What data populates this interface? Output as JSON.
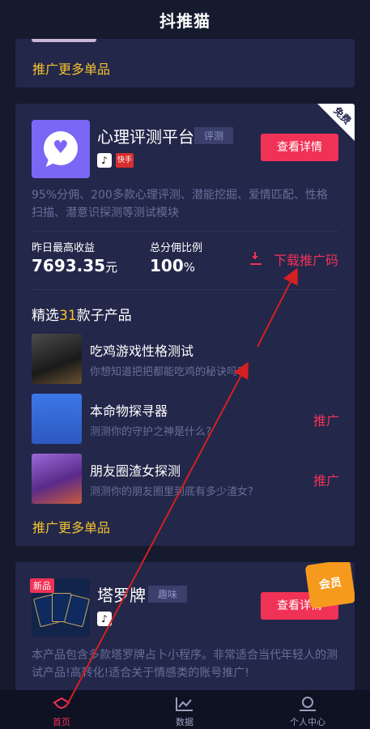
{
  "app": {
    "title": "抖推猫"
  },
  "card_top": {
    "more_label": "推广更多单品"
  },
  "main_product": {
    "corner_badge": "免费",
    "name": "心理评测平台",
    "tag": "评测",
    "platform_badges": [
      "tiktok-icon",
      "kuaishou-icon"
    ],
    "kuaishou_label": "快手",
    "detail_button": "查看详情",
    "description": "95%分佣、200多款心理评测、潜能挖掘、爱情匹配、性格扫描、潜意识探测等测试模块",
    "stats": {
      "income_label": "昨日最高收益",
      "income_value": "7693.35",
      "income_unit": "元",
      "ratio_label": "总分佣比例",
      "ratio_value": "100",
      "ratio_unit": "%"
    },
    "download_label": "下载推广码",
    "section_prefix": "精选",
    "section_count": "31",
    "section_suffix": "款子产品",
    "sub_products": [
      {
        "name": "吃鸡游戏性格测试",
        "desc": "你想知道把把都能吃鸡的秘诀吗?",
        "action": ""
      },
      {
        "name": "本命物探寻器",
        "desc": "测测你的守护之神是什么?",
        "action": "推广"
      },
      {
        "name": "朋友圈渣女探测",
        "desc": "测测你的朋友圈里到底有多少渣女?",
        "action": "推广"
      }
    ],
    "more_label": "推广更多单品"
  },
  "second_product": {
    "new_tag": "新品",
    "vip_badge": "会员",
    "name": "塔罗牌",
    "tag": "趣味",
    "detail_button": "查看详情",
    "description": "本产品包含多款塔罗牌占卜小程序。非常适合当代年轻人的测试产品!高转化!适合关于情感类的账号推广!"
  },
  "tabbar": {
    "tabs": [
      {
        "label": "首页",
        "icon": "home-icon",
        "active": true
      },
      {
        "label": "数据",
        "icon": "chart-icon",
        "active": false
      },
      {
        "label": "个人中心",
        "icon": "user-icon",
        "active": false
      }
    ]
  },
  "colors": {
    "background": "#161a2e",
    "card": "#23274a",
    "accent": "#f03256",
    "highlight": "#f5c32f",
    "muted_text": "#686e99"
  }
}
